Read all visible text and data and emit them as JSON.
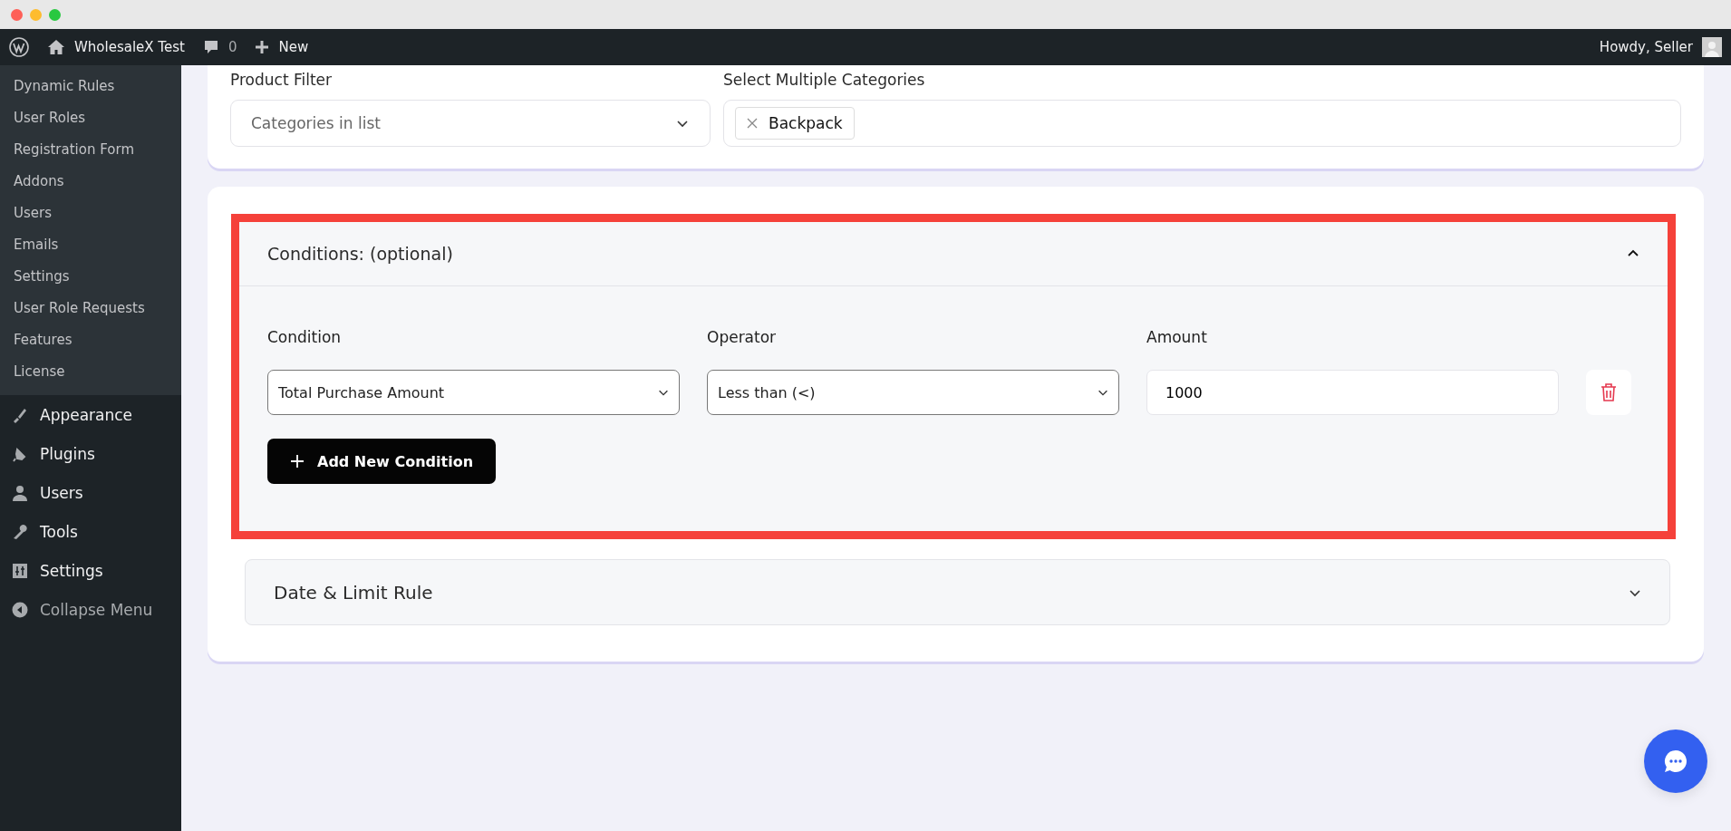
{
  "admin_bar": {
    "site": "WholesaleX Test",
    "comments": "0",
    "new": "New",
    "greeting": "Howdy, Seller"
  },
  "sidebar": {
    "submenu": [
      {
        "label": "Dynamic Rules"
      },
      {
        "label": "User Roles"
      },
      {
        "label": "Registration Form"
      },
      {
        "label": "Addons"
      },
      {
        "label": "Users"
      },
      {
        "label": "Emails"
      },
      {
        "label": "Settings"
      },
      {
        "label": "User Role Requests"
      },
      {
        "label": "Features"
      },
      {
        "label": "License"
      }
    ],
    "menu": [
      {
        "label": "Appearance",
        "kind": "brush"
      },
      {
        "label": "Plugins",
        "kind": "plug"
      },
      {
        "label": "Users",
        "kind": "user"
      },
      {
        "label": "Tools",
        "kind": "wrench"
      },
      {
        "label": "Settings",
        "kind": "sliders"
      },
      {
        "label": "Collapse Menu",
        "kind": "collapse"
      }
    ]
  },
  "filter": {
    "product_filter": {
      "label": "Product Filter",
      "value": "Categories in list"
    },
    "categories": {
      "label": "Select Multiple Categories",
      "tags": [
        "Backpack"
      ]
    }
  },
  "conditions": {
    "title": "Conditions: (optional)",
    "expanded": true,
    "highlighted": true,
    "columns": [
      "Condition",
      "Operator",
      "Amount"
    ],
    "rows": [
      {
        "condition": "Total Purchase Amount",
        "operator": "Less than (<)",
        "amount": "1000"
      }
    ],
    "add_button": "Add New Condition"
  },
  "date_limit": {
    "title": "Date & Limit Rule",
    "expanded": false
  }
}
